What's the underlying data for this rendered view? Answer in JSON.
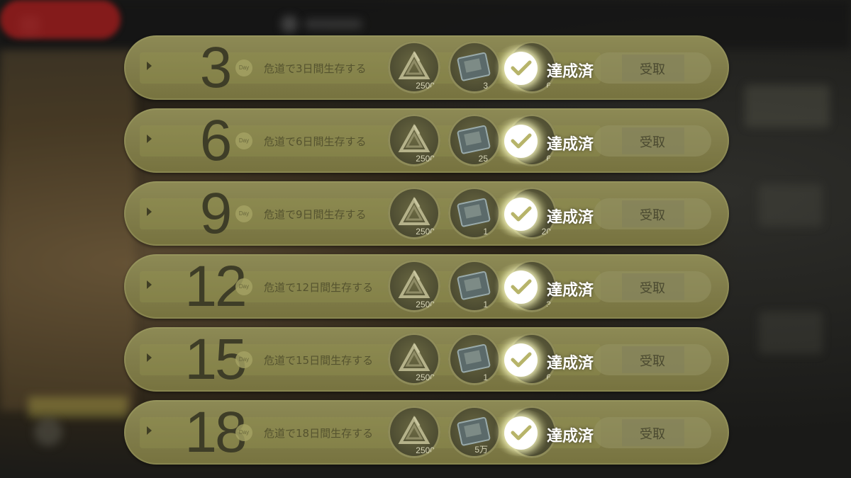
{
  "checkmark_color": "#b7b46a",
  "rows": [
    {
      "day": "3",
      "day_badge": "Day",
      "mission": "危道で3日間生存する",
      "reward1_count": "2500",
      "reward2_count": "3",
      "reward3_count": "6",
      "status": "達成済",
      "claim": "受取"
    },
    {
      "day": "6",
      "day_badge": "Day",
      "mission": "危道で6日間生存する",
      "reward1_count": "2500",
      "reward2_count": "25",
      "reward3_count": "6",
      "status": "達成済",
      "claim": "受取"
    },
    {
      "day": "9",
      "day_badge": "Day",
      "mission": "危道で9日間生存する",
      "reward1_count": "2500",
      "reward2_count": "1",
      "reward3_count": "20",
      "status": "達成済",
      "claim": "受取"
    },
    {
      "day": "12",
      "day_badge": "Day",
      "mission": "危道で12日間生存する",
      "reward1_count": "2500",
      "reward2_count": "1",
      "reward3_count": "3",
      "status": "達成済",
      "claim": "受取"
    },
    {
      "day": "15",
      "day_badge": "Day",
      "mission": "危道で15日間生存する",
      "reward1_count": "2500",
      "reward2_count": "1",
      "reward3_count": "6",
      "status": "達成済",
      "claim": "受取"
    },
    {
      "day": "18",
      "day_badge": "Day",
      "mission": "危道で18日間生存する",
      "reward1_count": "2500",
      "reward2_count": "5万",
      "reward3_count": "",
      "status": "達成済",
      "claim": "受取"
    }
  ]
}
